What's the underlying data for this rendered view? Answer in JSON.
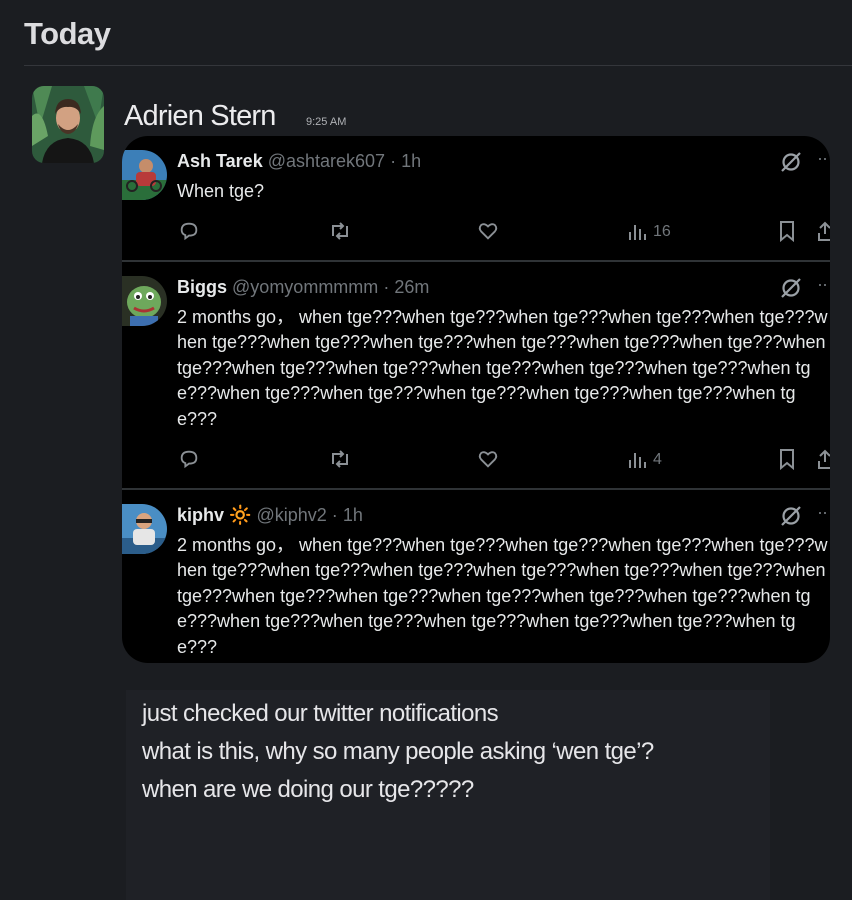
{
  "day_header": "Today",
  "message": {
    "sender": "Adrien Stern",
    "time": "9:25 AM",
    "lines": [
      "just checked our twitter notifications",
      "what is this, why so many people asking ‘wen tge’?",
      "when are we doing our tge?????"
    ]
  },
  "tweets": [
    {
      "name": "Ash Tarek",
      "handle": "@ashtarek607",
      "sep": "·",
      "age": "1h",
      "text": "When tge?",
      "views": "16"
    },
    {
      "name": "Biggs",
      "handle": "@yomyommmmm",
      "sep": "·",
      "age": "26m",
      "text": "2 months go， when tge???when tge???when tge???when tge???when tge???when tge???when tge???when tge???when tge???when tge???when tge???when tge???when tge???when tge???when tge???when tge???when tge???when tge???when tge???when tge???when tge???when tge???when tge???when tge???",
      "views": "4"
    },
    {
      "name": "kiphv",
      "emoji": "🔆",
      "handle": "@kiphv2",
      "sep": "·",
      "age": "1h",
      "text": "2 months go， when tge???when tge???when tge???when tge???when tge???when tge???when tge???when tge???when tge???when tge???when tge???when tge???when tge???when tge???when tge???when tge???when tge???when tge???when tge???when tge???when tge???when tge???when tge???when tge???"
    }
  ],
  "icons": {
    "reply": "reply-icon",
    "retweet": "retweet-icon",
    "like": "heart-icon",
    "views": "views-icon",
    "bookmark": "bookmark-icon",
    "share": "share-icon",
    "grok": "grok-logo-icon",
    "more": "more-icon"
  },
  "colors": {
    "background": "#1b1d21",
    "embed_background": "#000000",
    "muted_text": "#71767b"
  }
}
